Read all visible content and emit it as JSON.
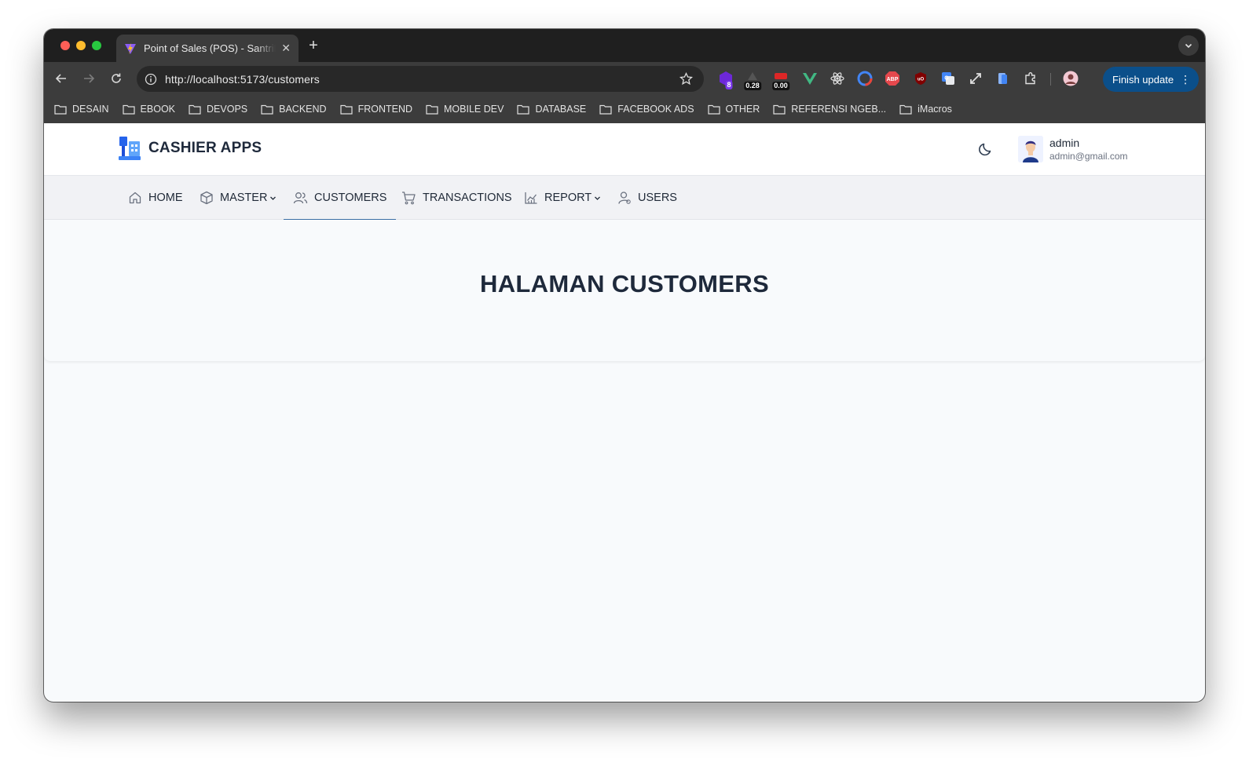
{
  "browser": {
    "tab_title": "Point of Sales (POS) - SantriKoding",
    "new_tab_symbol": "+",
    "tab_close_symbol": "✕",
    "url": "http://localhost:5173/customers",
    "extensions": [
      {
        "name": "extension-badge-8",
        "badge": "8"
      },
      {
        "name": "cls-metric",
        "badge": "0.28"
      },
      {
        "name": "lcp-metric",
        "badge": "0.00"
      }
    ],
    "finish_update_label": "Finish update",
    "menu_symbol": "⋮",
    "bookmarks": [
      "DESAIN",
      "EBOOK",
      "DEVOPS",
      "BACKEND",
      "FRONTEND",
      "MOBILE DEV",
      "DATABASE",
      "FACEBOOK ADS",
      "OTHER",
      "REFERENSI NGEB...",
      "iMacros"
    ]
  },
  "app": {
    "brand": "CASHIER APPS",
    "user": {
      "name": "admin",
      "email": "admin@gmail.com"
    },
    "nav": {
      "home": "HOME",
      "master": "MASTER",
      "customers": "CUSTOMERS",
      "transactions": "TRANSACTIONS",
      "report": "REPORT",
      "users": "USERS"
    },
    "active_nav": "CUSTOMERS",
    "page_heading": "HALAMAN CUSTOMERS"
  },
  "colors": {
    "accent": "#3b6ea5",
    "finish_update_bg": "#0b4f8a",
    "heading": "#1e293b"
  }
}
